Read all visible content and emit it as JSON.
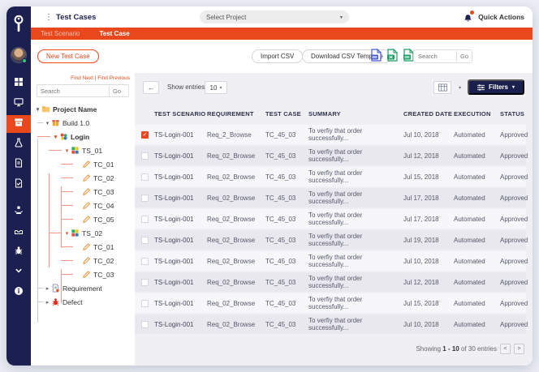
{
  "icons": {
    "kebab": "⋮",
    "caret_down": "▾",
    "caret_select": "▾",
    "back_arrow": "←"
  },
  "topbar": {
    "title": "Test Cases",
    "project_selector": "Select Project",
    "quick_actions": "Quick Actions",
    "icon_names": [
      "kebab-icon",
      "bell-icon"
    ]
  },
  "tabs": [
    {
      "label": "Test Scenario",
      "active": false
    },
    {
      "label": "Test Case",
      "active": true
    }
  ],
  "toolbar": {
    "new_test_case": "New Test Case",
    "import_csv": "Import CSV",
    "download_csv_template": "Download CSV Template",
    "search_placeholder": "Search",
    "search_go": "Go",
    "export_icon_names": [
      "pdf-export-icon",
      "excel-export-icon",
      "csv-export-icon"
    ]
  },
  "sidebar": {
    "items": [
      {
        "name": "dashboard",
        "icon": "grid",
        "active": false
      },
      {
        "name": "projects",
        "icon": "monitor",
        "active": false
      },
      {
        "name": "test-cases",
        "icon": "archive",
        "active": true
      },
      {
        "name": "test-lab",
        "icon": "flask",
        "active": false
      },
      {
        "name": "reports",
        "icon": "file",
        "active": false
      },
      {
        "name": "test-review",
        "icon": "fileCheck",
        "active": false
      },
      {
        "name": "delivery",
        "icon": "hand",
        "active": false
      },
      {
        "name": "builds",
        "icon": "tray",
        "active": false
      },
      {
        "name": "defects",
        "icon": "bug",
        "active": false
      },
      {
        "name": "more",
        "icon": "chevron",
        "active": false
      },
      {
        "name": "info",
        "icon": "info",
        "active": false
      }
    ]
  },
  "tree_panel": {
    "find_links": "Find Next | Find Previous",
    "search_placeholder": "Search",
    "go": "Go",
    "items": [
      {
        "label": "Project Name",
        "icon": "folder",
        "caret": "down",
        "depth": 0,
        "conn": "none"
      },
      {
        "label": "Build 1.0",
        "icon": "build",
        "caret": "down",
        "depth": 1,
        "conn": "gray"
      },
      {
        "label": "Login",
        "icon": "login",
        "caret": "down-red",
        "depth": 2,
        "conn": "red"
      },
      {
        "label": "TS_01",
        "icon": "ts",
        "caret": "down-red",
        "depth": 3,
        "conn": "red"
      },
      {
        "label": "TC_01",
        "icon": "tc",
        "caret": "none",
        "depth": 4,
        "conn": "red"
      },
      {
        "label": "TC_02",
        "icon": "tc",
        "caret": "none",
        "depth": 4,
        "conn": "red"
      },
      {
        "label": "TC_03",
        "icon": "tc",
        "caret": "none",
        "depth": 4,
        "conn": "red"
      },
      {
        "label": "TC_04",
        "icon": "tc",
        "caret": "none",
        "depth": 4,
        "conn": "red"
      },
      {
        "label": "TC_05",
        "icon": "tc",
        "caret": "none",
        "depth": 4,
        "conn": "red"
      },
      {
        "label": "TS_02",
        "icon": "ts",
        "caret": "down-red",
        "depth": 3,
        "conn": "red"
      },
      {
        "label": "TC_01",
        "icon": "tc",
        "caret": "none",
        "depth": 4,
        "conn": "red"
      },
      {
        "label": "TC_02",
        "icon": "tc",
        "caret": "none",
        "depth": 4,
        "conn": "red"
      },
      {
        "label": "TC_03",
        "icon": "tc",
        "caret": "none",
        "depth": 4,
        "conn": "red"
      },
      {
        "label": "Requirement",
        "icon": "requirement",
        "caret": "right",
        "depth": 1,
        "conn": "gray"
      },
      {
        "label": "Defect",
        "icon": "defect",
        "caret": "right",
        "depth": 1,
        "conn": "gray"
      }
    ]
  },
  "table": {
    "show_entries_label": "Show entries",
    "entries_value": "10",
    "filters_label": "Filters",
    "columns": [
      "TEST SCENARIO",
      "REQUIREMENT",
      "TEST CASE",
      "SUMMARY",
      "CREATED DATE",
      "EXECUTION",
      "STATUS"
    ],
    "rows": [
      {
        "checked": true,
        "scenario": "TS-Login-001",
        "requirement": "Req_2_Browse",
        "testcase": "TC_45_03",
        "summary": "To verfiy that order successfully...",
        "date": "Jul 10, 2018",
        "execution": "Automated",
        "status": "Approved"
      },
      {
        "checked": false,
        "scenario": "TS-Login-001",
        "requirement": "Req_02_Browse",
        "testcase": "TC_45_03",
        "summary": "To verfiy that order successfully...",
        "date": "Jul 12, 2018",
        "execution": "Automated",
        "status": "Approved"
      },
      {
        "checked": false,
        "scenario": "TS-Login-001",
        "requirement": "Req_02_Browse",
        "testcase": "TC_45_03",
        "summary": "To verfiy that order successfully...",
        "date": "Jul 15, 2018",
        "execution": "Automated",
        "status": "Approved"
      },
      {
        "checked": false,
        "scenario": "TS-Login-001",
        "requirement": "Req_02_Browse",
        "testcase": "TC_45_03",
        "summary": "To verfiy that order successfully...",
        "date": "Jul 17, 2018",
        "execution": "Automated",
        "status": "Approved"
      },
      {
        "checked": false,
        "scenario": "TS-Login-001",
        "requirement": "Req_02_Browse",
        "testcase": "TC_45_03",
        "summary": "To verfiy that order successfully...",
        "date": "Jul 17, 2018",
        "execution": "Automated",
        "status": "Approved"
      },
      {
        "checked": false,
        "scenario": "TS-Login-001",
        "requirement": "Req_02_Browse",
        "testcase": "TC_45_03",
        "summary": "To verfiy that order successfully...",
        "date": "Jul 19, 2018",
        "execution": "Automated",
        "status": "Approved"
      },
      {
        "checked": false,
        "scenario": "TS-Login-001",
        "requirement": "Req_02_Browse",
        "testcase": "TC_45_03",
        "summary": "To verfiy that order successfully...",
        "date": "Jul 10, 2018",
        "execution": "Automated",
        "status": "Approved"
      },
      {
        "checked": false,
        "scenario": "TS-Login-001",
        "requirement": "Req_02_Browse",
        "testcase": "TC_45_03",
        "summary": "To verfiy that order successfully...",
        "date": "Jul 12, 2018",
        "execution": "Automated",
        "status": "Approved"
      },
      {
        "checked": false,
        "scenario": "TS-Login-001",
        "requirement": "Req_02_Browse",
        "testcase": "TC_45_03",
        "summary": "To verfiy that order successfully...",
        "date": "Jul 15, 2018",
        "execution": "Automated",
        "status": "Approved"
      },
      {
        "checked": false,
        "scenario": "TS-Login-001",
        "requirement": "Req_02_Browse",
        "testcase": "TC_45_03",
        "summary": "To verfiy that order successfully...",
        "date": "Jul 10, 2018",
        "execution": "Automated",
        "status": "Approved"
      }
    ],
    "footer": {
      "showing_prefix": "Showing",
      "range": "1 - 10",
      "suffix": "of 30 entries",
      "prev": "<",
      "next": ">"
    }
  },
  "colors": {
    "accent": "#E8481C",
    "navy": "#1B2050",
    "button_navy": "#1B1F4E",
    "row_alt": "#E9E8EE",
    "tree_connector": "#F0998A"
  }
}
